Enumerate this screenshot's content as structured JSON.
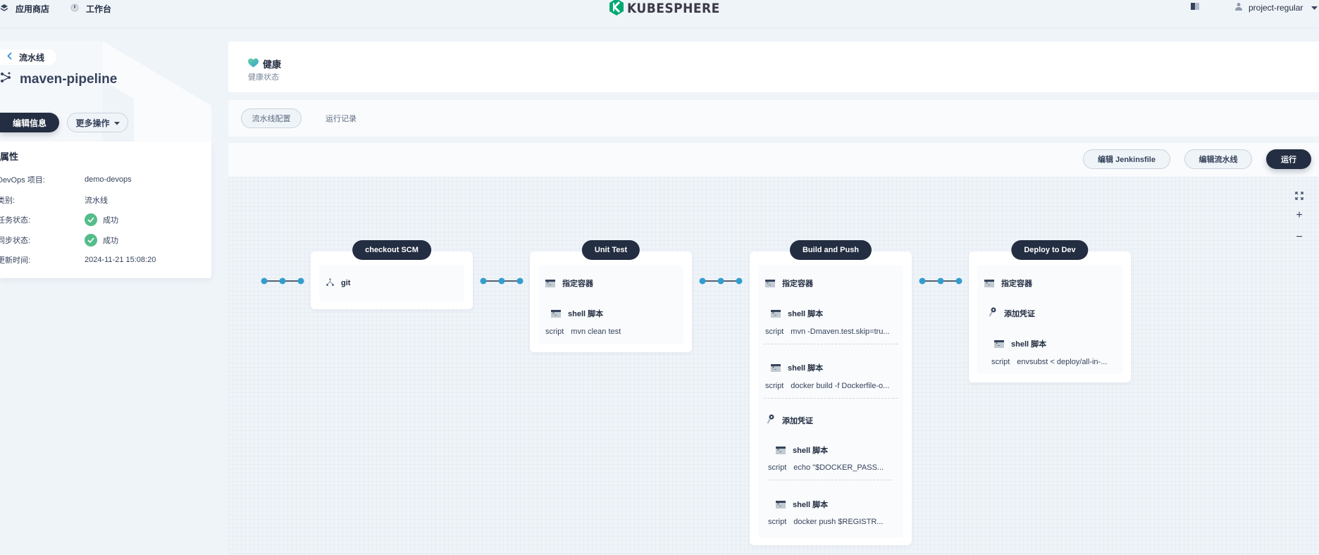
{
  "topnav": {
    "app_store": "应用商店",
    "workbench": "工作台",
    "logo_text": "KUBESPHERE",
    "user": "project-regular",
    "brand_color": "#00a971"
  },
  "detail": {
    "back_label": "流水线",
    "title": "maven-pipeline",
    "edit_info": "编辑信息",
    "more_actions": "更多操作",
    "props_title": "属性",
    "props": [
      {
        "label": "DevOps 项目:",
        "value": "demo-devops"
      },
      {
        "label": "类别:",
        "value": "流水线"
      },
      {
        "label": "任务状态:",
        "value": "成功",
        "status": "success"
      },
      {
        "label": "同步状态:",
        "value": "成功",
        "status": "success"
      },
      {
        "label": "更新时间:",
        "value": "2024-11-21 15:08:20"
      }
    ]
  },
  "health": {
    "title": "健康",
    "subtitle": "健康状态"
  },
  "tabs": [
    {
      "label": "流水线配置",
      "active": true
    },
    {
      "label": "运行记录",
      "active": false
    }
  ],
  "toolbar": {
    "edit_jenkinsfile": "编辑 Jenkinsfile",
    "edit_pipeline": "编辑流水线",
    "run": "运行"
  },
  "zoom_controls": {
    "fit": "⛶",
    "plus": "+",
    "minus": "−"
  },
  "stages": [
    {
      "name": "checkout SCM",
      "steps": [
        {
          "type": "git",
          "label": "git"
        }
      ]
    },
    {
      "name": "Unit Test",
      "steps": [
        {
          "type": "container",
          "label": "指定容器"
        },
        {
          "type": "shell",
          "label": "shell 脚本",
          "script_key": "script",
          "script": "mvn clean test"
        }
      ]
    },
    {
      "name": "Build and Push",
      "steps": [
        {
          "type": "container",
          "label": "指定容器"
        },
        {
          "type": "shell",
          "label": "shell 脚本",
          "script_key": "script",
          "script": "mvn -Dmaven.test.skip=tru..."
        },
        {
          "type": "shell",
          "label": "shell 脚本",
          "script_key": "script",
          "script": "docker build -f Dockerfile-o..."
        },
        {
          "type": "credential",
          "label": "添加凭证"
        },
        {
          "type": "shell",
          "label": "shell 脚本",
          "script_key": "script",
          "script": "echo \"$DOCKER_PASS..."
        },
        {
          "type": "shell",
          "label": "shell 脚本",
          "script_key": "script",
          "script": "docker push $REGISTR..."
        }
      ]
    },
    {
      "name": "Deploy to Dev",
      "steps": [
        {
          "type": "container",
          "label": "指定容器"
        },
        {
          "type": "credential",
          "label": "添加凭证"
        },
        {
          "type": "shell",
          "label": "shell 脚本",
          "script_key": "script",
          "script": "envsubst < deploy/all-in-..."
        }
      ]
    }
  ]
}
